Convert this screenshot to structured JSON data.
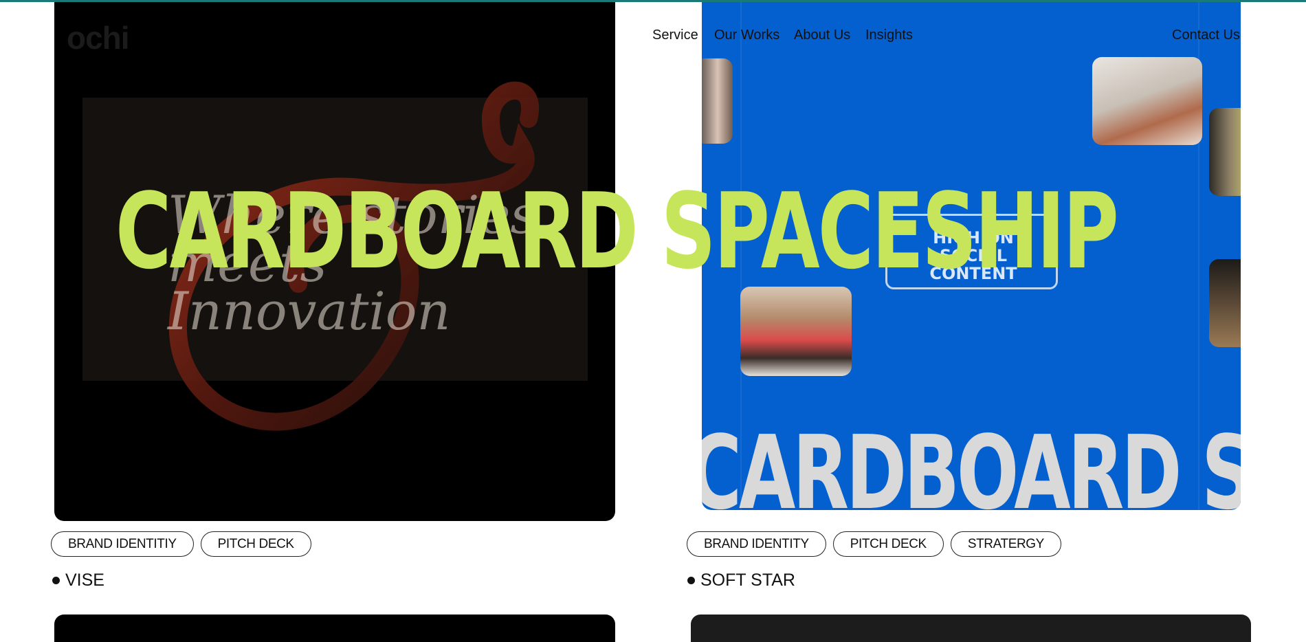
{
  "header": {
    "logo": "ochi",
    "nav": [
      {
        "label": "Service"
      },
      {
        "label": "Our Works"
      },
      {
        "label": "About Us"
      },
      {
        "label": "Insights"
      }
    ],
    "contact": "Contact Us"
  },
  "hero": {
    "title": "CARDBOARD SPACESHIP"
  },
  "cards": [
    {
      "name": "VISE",
      "ghost_text": "Where stories meets Innovation",
      "tags": [
        "BRAND IDENTITIY",
        "PITCH DECK"
      ]
    },
    {
      "name": "SOFT STAR",
      "marquee_text": "CARDBOARD SPACESHIP",
      "badge_text": "HIGH ON SOCIAL CONTENT",
      "tags": [
        "BRAND IDENTITY",
        "PITCH DECK",
        "STRATERGY"
      ]
    }
  ],
  "colors": {
    "title_lime": "#c7e55b",
    "card_blue": "#0560cf",
    "top_accent": "#1a7a78"
  }
}
